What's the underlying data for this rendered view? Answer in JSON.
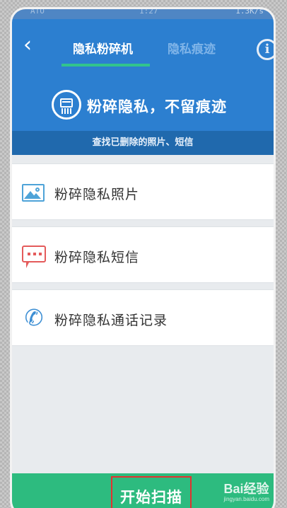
{
  "status_bar": {
    "left": "ATO",
    "time": "1:27",
    "right": "1.3K/s"
  },
  "header": {
    "back_icon": "chevron-left-icon",
    "tabs": [
      {
        "label": "隐私粉碎机",
        "active": true
      },
      {
        "label": "隐私痕迹",
        "active": false
      }
    ],
    "info_icon": "info-icon",
    "hero_title": "粉碎隐私，不留痕迹",
    "subtitle": "查找已删除的照片、短信"
  },
  "list": [
    {
      "label": "粉碎隐私照片",
      "icon": "photo-icon",
      "color": "#4ea3d8"
    },
    {
      "label": "粉碎隐私短信",
      "icon": "sms-icon",
      "color": "#e45b5b"
    },
    {
      "label": "粉碎隐私通话记录",
      "icon": "phone-icon",
      "color": "#3d8fd4"
    }
  ],
  "bottom": {
    "start_label": "开始扫描",
    "watermark": "Bai经验",
    "watermark_sub": "jingyan.baidu.com"
  },
  "colors": {
    "header_blue": "#2c7fd0",
    "band_blue": "#2069ad",
    "tab_indicator": "#32c48d",
    "bottom_green": "#2dbb7f",
    "highlight_red": "#e3322f"
  }
}
